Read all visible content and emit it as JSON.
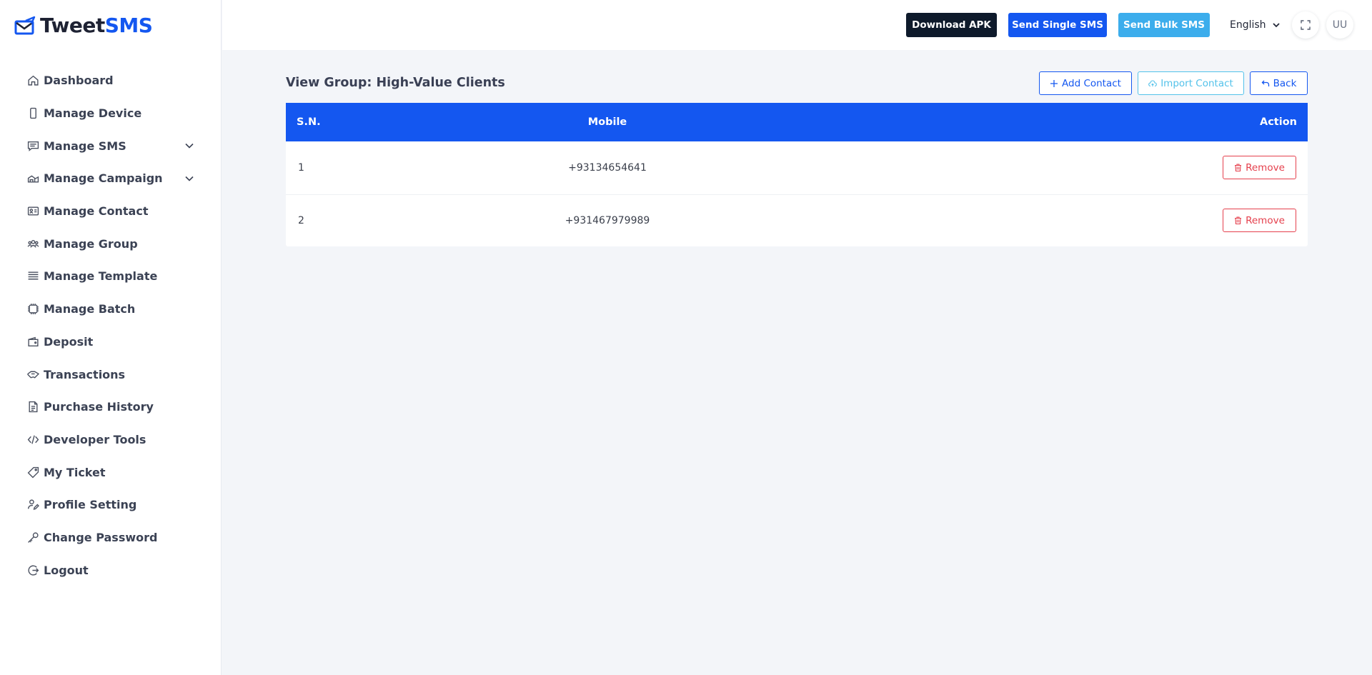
{
  "brand": {
    "name_part1": "Tweet",
    "name_part2": "SMS",
    "icon": "envelope-send-icon"
  },
  "sidebar": {
    "items": [
      {
        "label": "Dashboard",
        "icon": "home-icon"
      },
      {
        "label": "Manage Device",
        "icon": "phone-icon"
      },
      {
        "label": "Manage SMS",
        "icon": "message-icon",
        "expandable": true
      },
      {
        "label": "Manage Campaign",
        "icon": "campaign-icon",
        "expandable": true
      },
      {
        "label": "Manage Contact",
        "icon": "contact-card-icon"
      },
      {
        "label": "Manage Group",
        "icon": "group-icon"
      },
      {
        "label": "Manage Template",
        "icon": "template-icon"
      },
      {
        "label": "Manage Batch",
        "icon": "batch-icon"
      },
      {
        "label": "Deposit",
        "icon": "wallet-icon"
      },
      {
        "label": "Transactions",
        "icon": "transaction-icon"
      },
      {
        "label": "Purchase History",
        "icon": "receipt-icon"
      },
      {
        "label": "Developer Tools",
        "icon": "code-icon"
      },
      {
        "label": "My Ticket",
        "icon": "ticket-icon"
      },
      {
        "label": "Profile Setting",
        "icon": "user-edit-icon"
      },
      {
        "label": "Change Password",
        "icon": "key-icon"
      },
      {
        "label": "Logout",
        "icon": "logout-icon"
      }
    ]
  },
  "header": {
    "download_apk": "Download APK",
    "send_single": "Send Single SMS",
    "send_bulk": "Send Bulk SMS",
    "language": "English",
    "avatar_initials": "UU"
  },
  "main": {
    "title": "View Group: High-Value Clients",
    "add_contact": "Add Contact",
    "import_contact": "Import Contact",
    "back": "Back",
    "table": {
      "headers": [
        "S.N.",
        "Mobile",
        "Action"
      ],
      "rows": [
        {
          "sn": "1",
          "mobile": "+93134654641",
          "action": "Remove"
        },
        {
          "sn": "2",
          "mobile": "+931467979989",
          "action": "Remove"
        }
      ]
    }
  },
  "colors": {
    "primary": "#1457f0",
    "dark": "#0e1a2b",
    "info": "#3cadec",
    "danger": "#e5404d",
    "background": "#f3f5f9"
  }
}
